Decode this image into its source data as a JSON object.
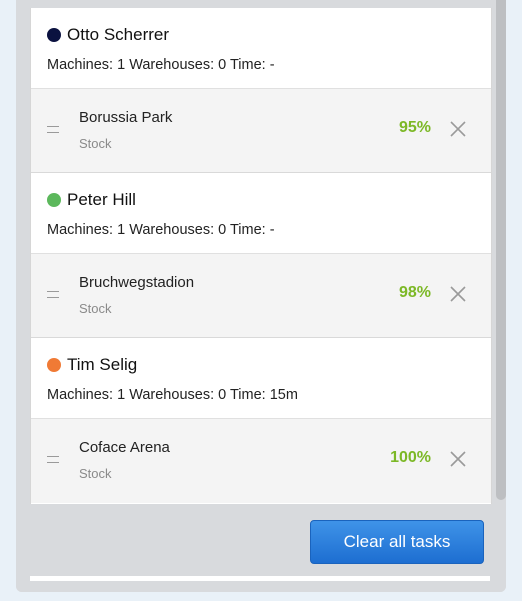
{
  "groups": [
    {
      "name": "Otto Scherrer",
      "dot_color": "#0b1240",
      "meta": "Machines: 1 Warehouses: 0 Time: -",
      "task": {
        "name": "Borussia Park",
        "sub": "Stock",
        "percent": "95%"
      }
    },
    {
      "name": "Peter Hill",
      "dot_color": "#5cb85c",
      "meta": "Machines: 1 Warehouses: 0 Time: -",
      "task": {
        "name": "Bruchwegstadion",
        "sub": "Stock",
        "percent": "98%"
      }
    },
    {
      "name": "Tim Selig",
      "dot_color": "#f07a35",
      "meta": "Machines: 1 Warehouses: 0 Time: 15m",
      "task": {
        "name": "Coface Arena",
        "sub": "Stock",
        "percent": "100%"
      }
    }
  ],
  "footer": {
    "clear_label": "Clear all tasks"
  },
  "colors": {
    "accent": "#1d6ed1",
    "percent": "#7cb826"
  },
  "icons": {
    "remove": "close-icon",
    "handle": "drag-handle-icon"
  }
}
